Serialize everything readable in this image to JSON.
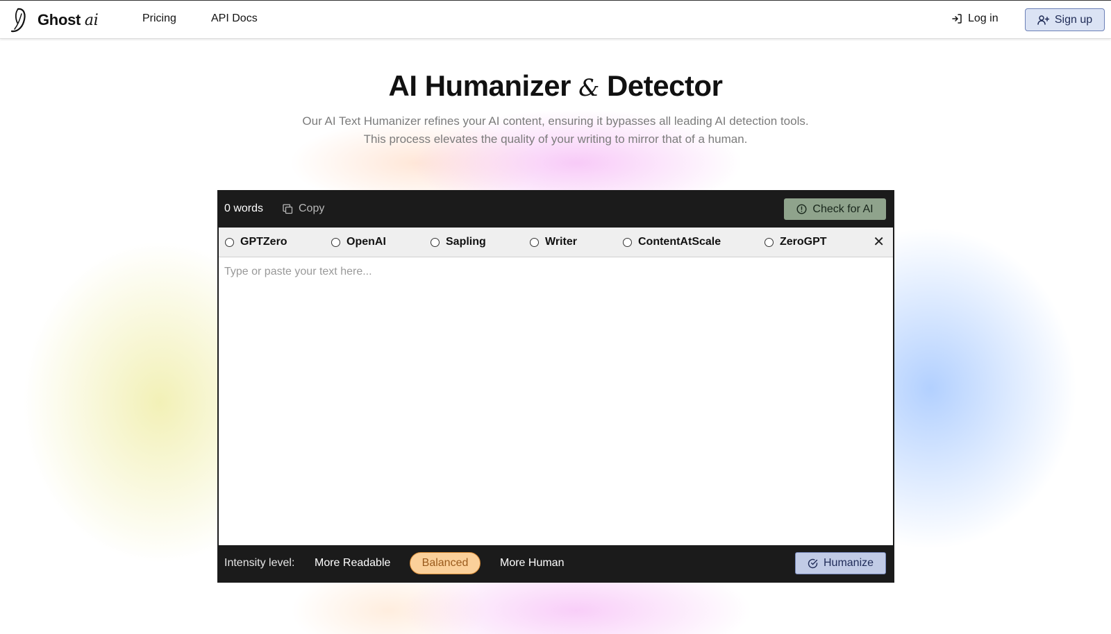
{
  "brand": {
    "name": "Ghost",
    "suffix": "ai"
  },
  "nav": {
    "links": [
      "Pricing",
      "API Docs"
    ],
    "login_label": "Log in",
    "signup_label": "Sign up"
  },
  "hero": {
    "title_part1": "AI Humanizer",
    "title_amp": "&",
    "title_part2": "Detector",
    "subtitle_line1": "Our AI Text Humanizer refines your AI content, ensuring it bypasses all leading AI detection tools.",
    "subtitle_line2": "This process elevates the quality of your writing to mirror that of a human."
  },
  "editor": {
    "word_count": "0 words",
    "copy_label": "Copy",
    "check_label": "Check for AI",
    "detectors": [
      "GPTZero",
      "OpenAI",
      "Sapling",
      "Writer",
      "ContentAtScale",
      "ZeroGPT"
    ],
    "placeholder": "Type or paste your text here...",
    "value": "",
    "intensity_label": "Intensity level:",
    "intensity_options": [
      "More Readable",
      "Balanced",
      "More Human"
    ],
    "intensity_selected": "Balanced",
    "humanize_label": "Humanize"
  },
  "icons": {
    "logo": "ghost-feather-icon",
    "login": "log-in-icon",
    "signup": "user-plus-icon",
    "copy": "copy-icon",
    "check": "alert-circle-icon",
    "close": "close-icon",
    "humanize": "check-circle-icon"
  },
  "colors": {
    "dark_bar": "#1b1b1b",
    "check_button": "#8fa38c",
    "balanced_pill": "#fbd09a",
    "humanize_button": "#c1cbe6",
    "signup_button": "#dbe3f4"
  }
}
